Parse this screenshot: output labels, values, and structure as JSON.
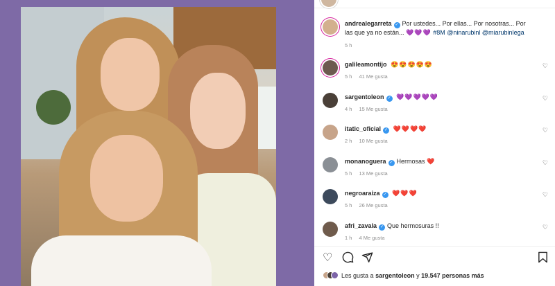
{
  "post": {
    "author": "andrealegarreta",
    "caption": "Por ustedes... Por ellas... Por nosotras... Por las que ya no están...",
    "caption_emojis": "💜💜💜",
    "hashtag": "#8M",
    "mentions": "@ninarubinl @miarubinlega",
    "time": "5 h"
  },
  "comments": [
    {
      "user": "galileamontijo",
      "verified": false,
      "text": "",
      "emojis": "😍😍😍😍😍",
      "emoji_class": "face",
      "time": "5 h",
      "likes": "41 Me gusta",
      "reply": ""
    },
    {
      "user": "sargentoleon",
      "verified": true,
      "text": "",
      "emojis": "💜💜💜💜💜",
      "emoji_class": "purple",
      "time": "4 h",
      "likes": "15 Me gusta",
      "reply": ""
    },
    {
      "user": "itatic_oficial",
      "verified": true,
      "text": "",
      "emojis": "❤️❤️❤️❤️",
      "emoji_class": "red",
      "time": "2 h",
      "likes": "10 Me gusta",
      "reply": ""
    },
    {
      "user": "monanoguera",
      "verified": true,
      "text": "Hermosas",
      "emojis": "❤️",
      "emoji_class": "red",
      "time": "5 h",
      "likes": "13 Me gusta",
      "reply": ""
    },
    {
      "user": "negroaraiza",
      "verified": true,
      "text": "",
      "emojis": "❤️❤️❤️",
      "emoji_class": "red",
      "time": "5 h",
      "likes": "26 Me gusta",
      "reply": ""
    },
    {
      "user": "afri_zavala",
      "verified": true,
      "text": "Que hermosuras !!",
      "emojis": "",
      "emoji_class": "",
      "time": "1 h",
      "likes": "4 Me gusta",
      "reply": ""
    }
  ],
  "likes_line": {
    "prefix": "Les gusta a",
    "user": "sargentoleon",
    "middle": "y",
    "count": "19.547 personas más"
  },
  "icons": {
    "like": "heart-icon",
    "comment": "comment-bubble-icon",
    "share": "paper-plane-icon",
    "save": "bookmark-icon"
  },
  "colors": {
    "background_panel": "#7e6aa6",
    "verified": "#3897f0",
    "link": "#00376b",
    "muted": "#8e8e8e"
  }
}
